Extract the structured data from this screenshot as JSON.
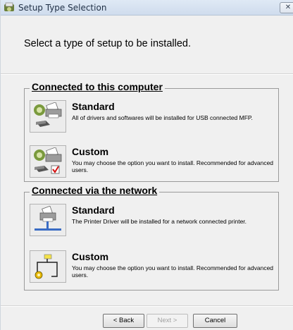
{
  "window": {
    "title": "Setup Type Selection",
    "close_glyph": "✕"
  },
  "heading": "Select a type of setup to be installed.",
  "groups": [
    {
      "title": "Connected to this computer",
      "options": [
        {
          "title": "Standard",
          "description": "All of drivers and softwares will be installed for USB connected MFP.",
          "icon": "usb-printer-standard-icon"
        },
        {
          "title": "Custom",
          "description": "You may choose the option you want to install. Recommended for advanced users.",
          "icon": "usb-printer-custom-icon"
        }
      ]
    },
    {
      "title": "Connected via the network",
      "options": [
        {
          "title": "Standard",
          "description": "The Printer Driver will be installed for a network connected printer.",
          "icon": "network-printer-standard-icon"
        },
        {
          "title": "Custom",
          "description": "You may choose the option you want to install. Recommended for advanced users.",
          "icon": "network-custom-icon"
        }
      ]
    }
  ],
  "buttons": {
    "back": "< Back",
    "next": "Next >",
    "cancel": "Cancel"
  }
}
